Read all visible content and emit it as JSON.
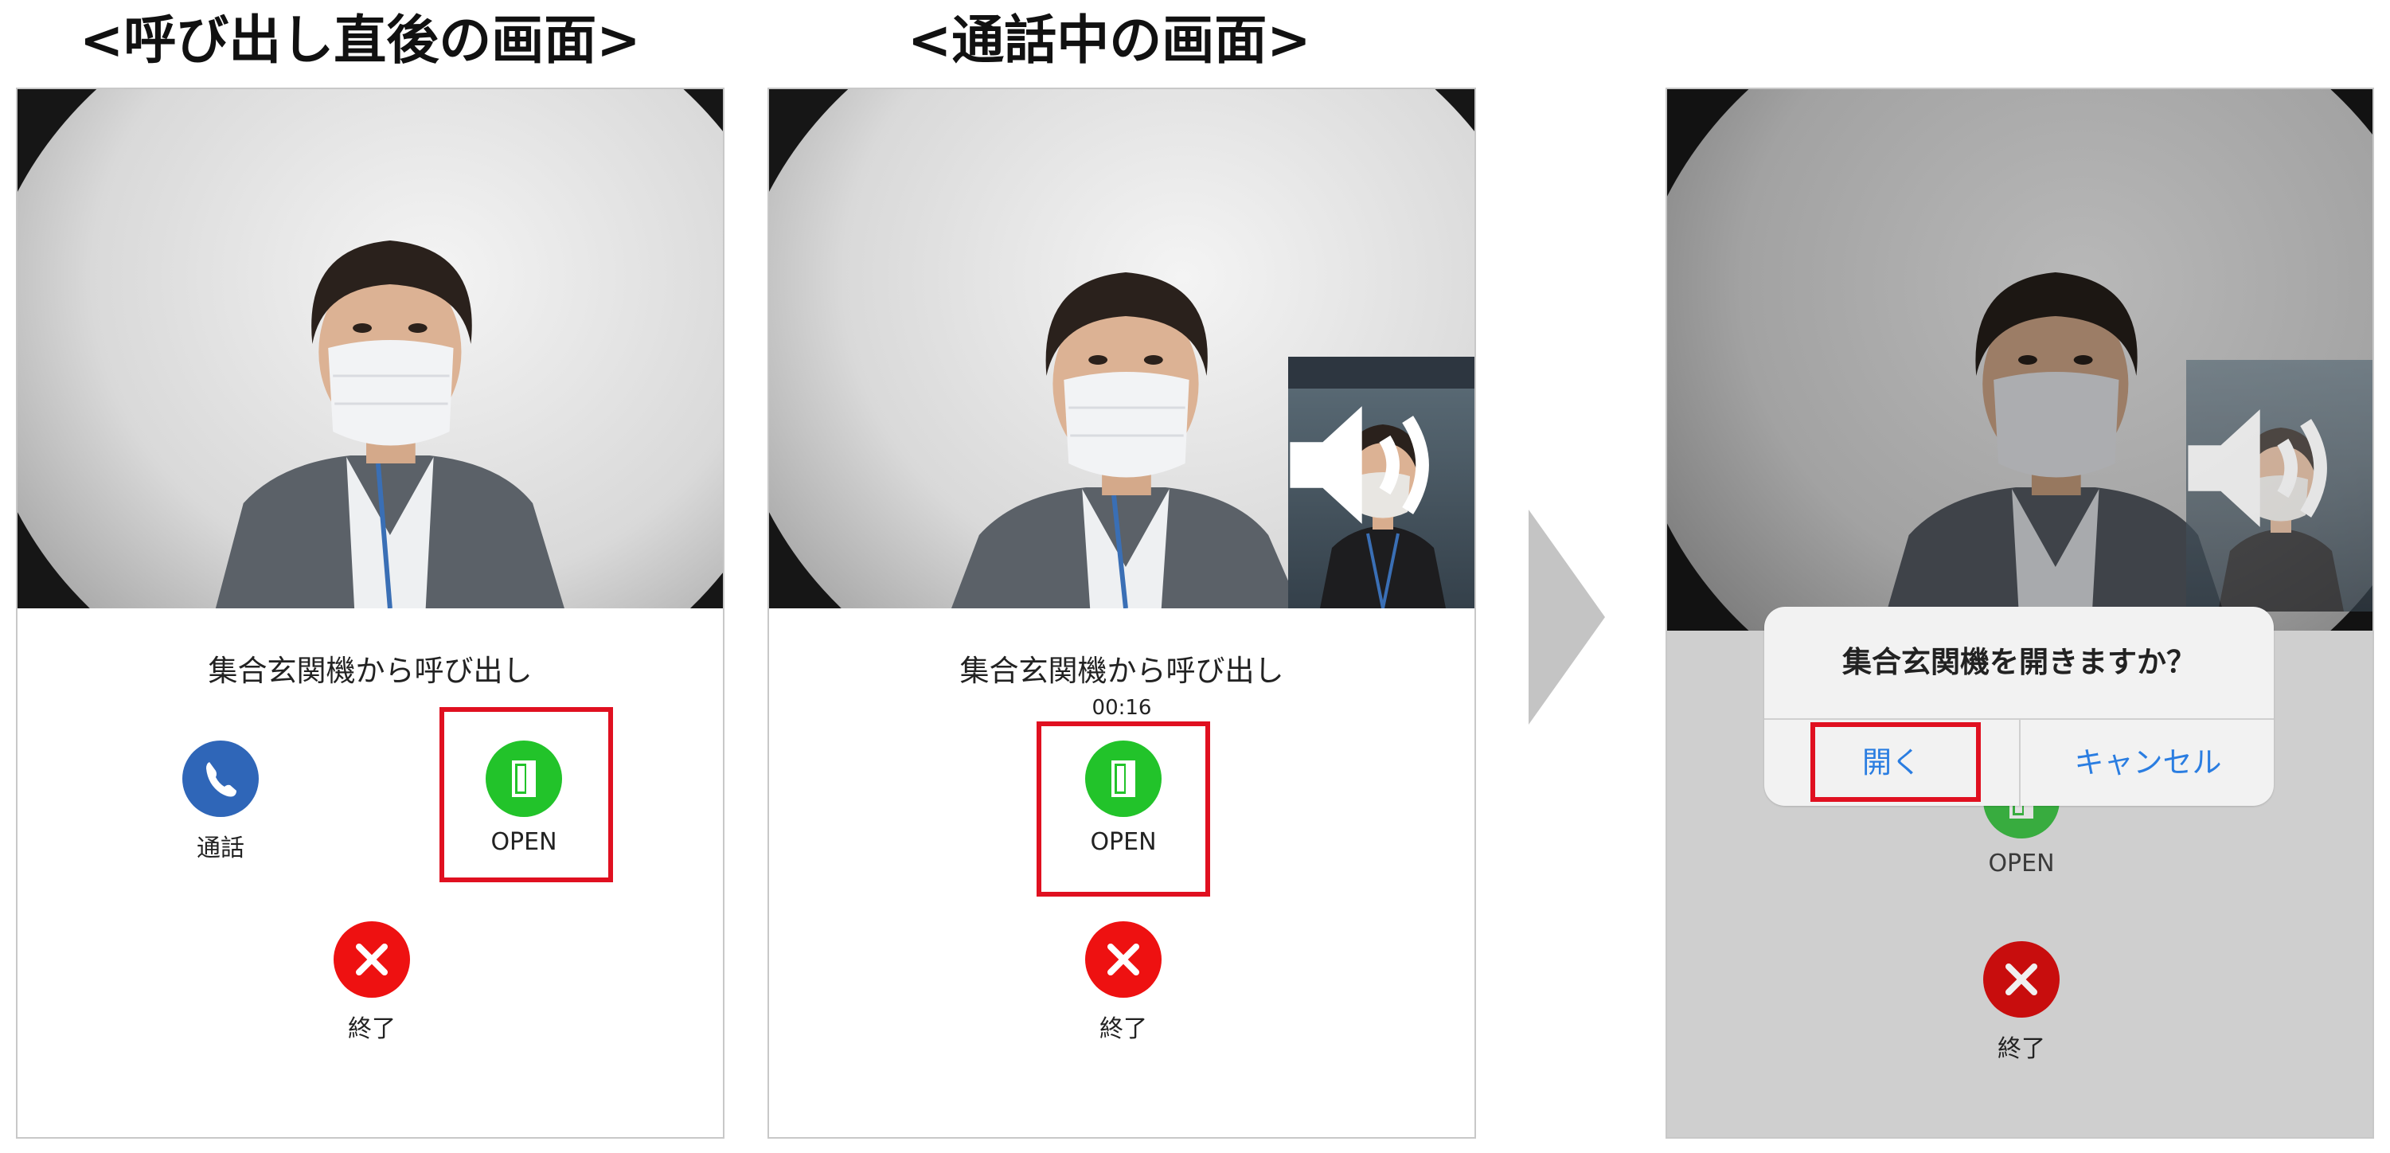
{
  "headings": {
    "left": "<呼び出し直後の画面>",
    "middle": "<通話中の画面>"
  },
  "panels": {
    "incoming": {
      "caller_text": "集合玄関機から呼び出し",
      "call_label": "通話",
      "open_label": "OPEN",
      "end_label": "終了"
    },
    "in_call": {
      "caller_text": "集合玄関機から呼び出し",
      "timer": "00:16",
      "open_label": "OPEN",
      "end_label": "終了"
    },
    "confirm": {
      "dialog_title": "集合玄関機を開きますか？",
      "open_button": "開く",
      "cancel_button": "キャンセル",
      "open_label": "OPEN",
      "end_label": "終了"
    }
  },
  "icons": {
    "call": "phone-icon",
    "open": "door-icon",
    "end": "close-icon",
    "speaker": "speaker-icon",
    "next": "arrow-right-icon"
  },
  "colors": {
    "call_button": "#2f66b8",
    "open_button": "#22c32a",
    "end_button": "#ee1111",
    "highlight": "#e01020",
    "dialog_action": "#2a7de1"
  }
}
